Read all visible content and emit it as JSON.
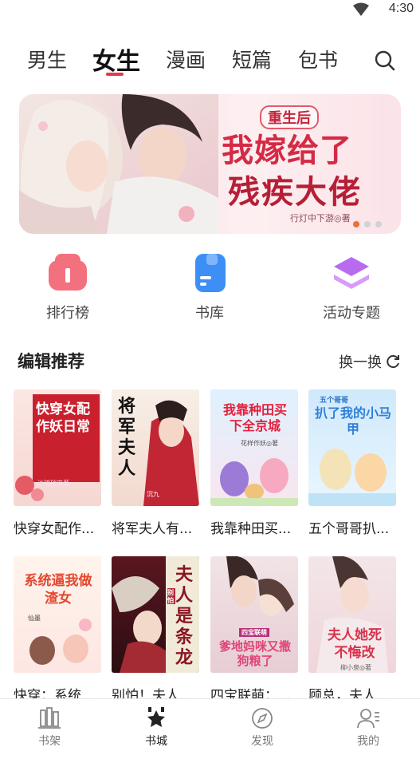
{
  "status": {
    "time": "4:30"
  },
  "tabs": [
    {
      "label": "男生"
    },
    {
      "label": "女生"
    },
    {
      "label": "漫画"
    },
    {
      "label": "短篇"
    },
    {
      "label": "包书"
    }
  ],
  "active_tab": "女生",
  "banner": {
    "pre_title": "重生后",
    "title_line1": "我嫁给了",
    "title_line2": "残疾大佬",
    "author": "行灯中下游◎著",
    "slide_count": 3,
    "active_slide": 1
  },
  "entries": [
    {
      "label": "排行榜",
      "icon": "ranking-icon"
    },
    {
      "label": "书库",
      "icon": "library-icon"
    },
    {
      "label": "活动专题",
      "icon": "activity-icon"
    }
  ],
  "section": {
    "title": "编辑推荐",
    "refresh_label": "换一换"
  },
  "books": [
    {
      "title": "快穿女配作妖日常",
      "display": "快穿女配作...",
      "cover_text": "快穿女配作妖日常",
      "cover_author": "沙琉瑞申著",
      "theme": "#c9202e"
    },
    {
      "title": "将军夫人有毒",
      "display": "将军夫人有...",
      "cover_text": "将军夫人",
      "cover_author": "沉九",
      "theme": "#b51d2a"
    },
    {
      "title": "我靠种田买下全京城",
      "display": "我靠种田买...",
      "cover_text": "我靠种田买下全京城",
      "cover_author": "花样作妖◎著",
      "theme": "#e84a5f"
    },
    {
      "title": "五个哥哥扒了我的小马甲",
      "display": "五个哥哥扒...",
      "cover_text": "扒了我的小马甲",
      "cover_author": "五个哥哥",
      "theme": "#2f7fd8"
    },
    {
      "title": "快穿：系统逼我做渣女",
      "display": "快穿：系统...",
      "cover_text": "系统逼我做渣女",
      "cover_author": "仙墨",
      "theme": "#e4472f"
    },
    {
      "title": "别怕！夫人是条龙",
      "display": "别怕！夫人...",
      "cover_text": "夫人是条龙",
      "cover_author": "别怕",
      "theme": "#f1ead9"
    },
    {
      "title": "四宝联萌：爹地妈咪又撒狗粮了",
      "display": "四宝联萌：...",
      "cover_text": "爹地妈咪又撒狗粮了",
      "cover_author": "四宝联萌",
      "theme": "#e0457a"
    },
    {
      "title": "顾总，夫人她死不悔改",
      "display": "顾总，夫人...",
      "cover_text": "夫人她死不悔改",
      "cover_author": "柳小泉◎著",
      "theme": "#d8334d"
    }
  ],
  "nav": [
    {
      "label": "书架",
      "icon": "bookshelf-icon"
    },
    {
      "label": "书城",
      "icon": "bookstore-icon"
    },
    {
      "label": "发现",
      "icon": "discover-icon"
    },
    {
      "label": "我的",
      "icon": "profile-icon"
    }
  ],
  "active_nav": "书城",
  "colors": {
    "accent": "#e8374a",
    "banner_dot_active": "#e8723a"
  }
}
